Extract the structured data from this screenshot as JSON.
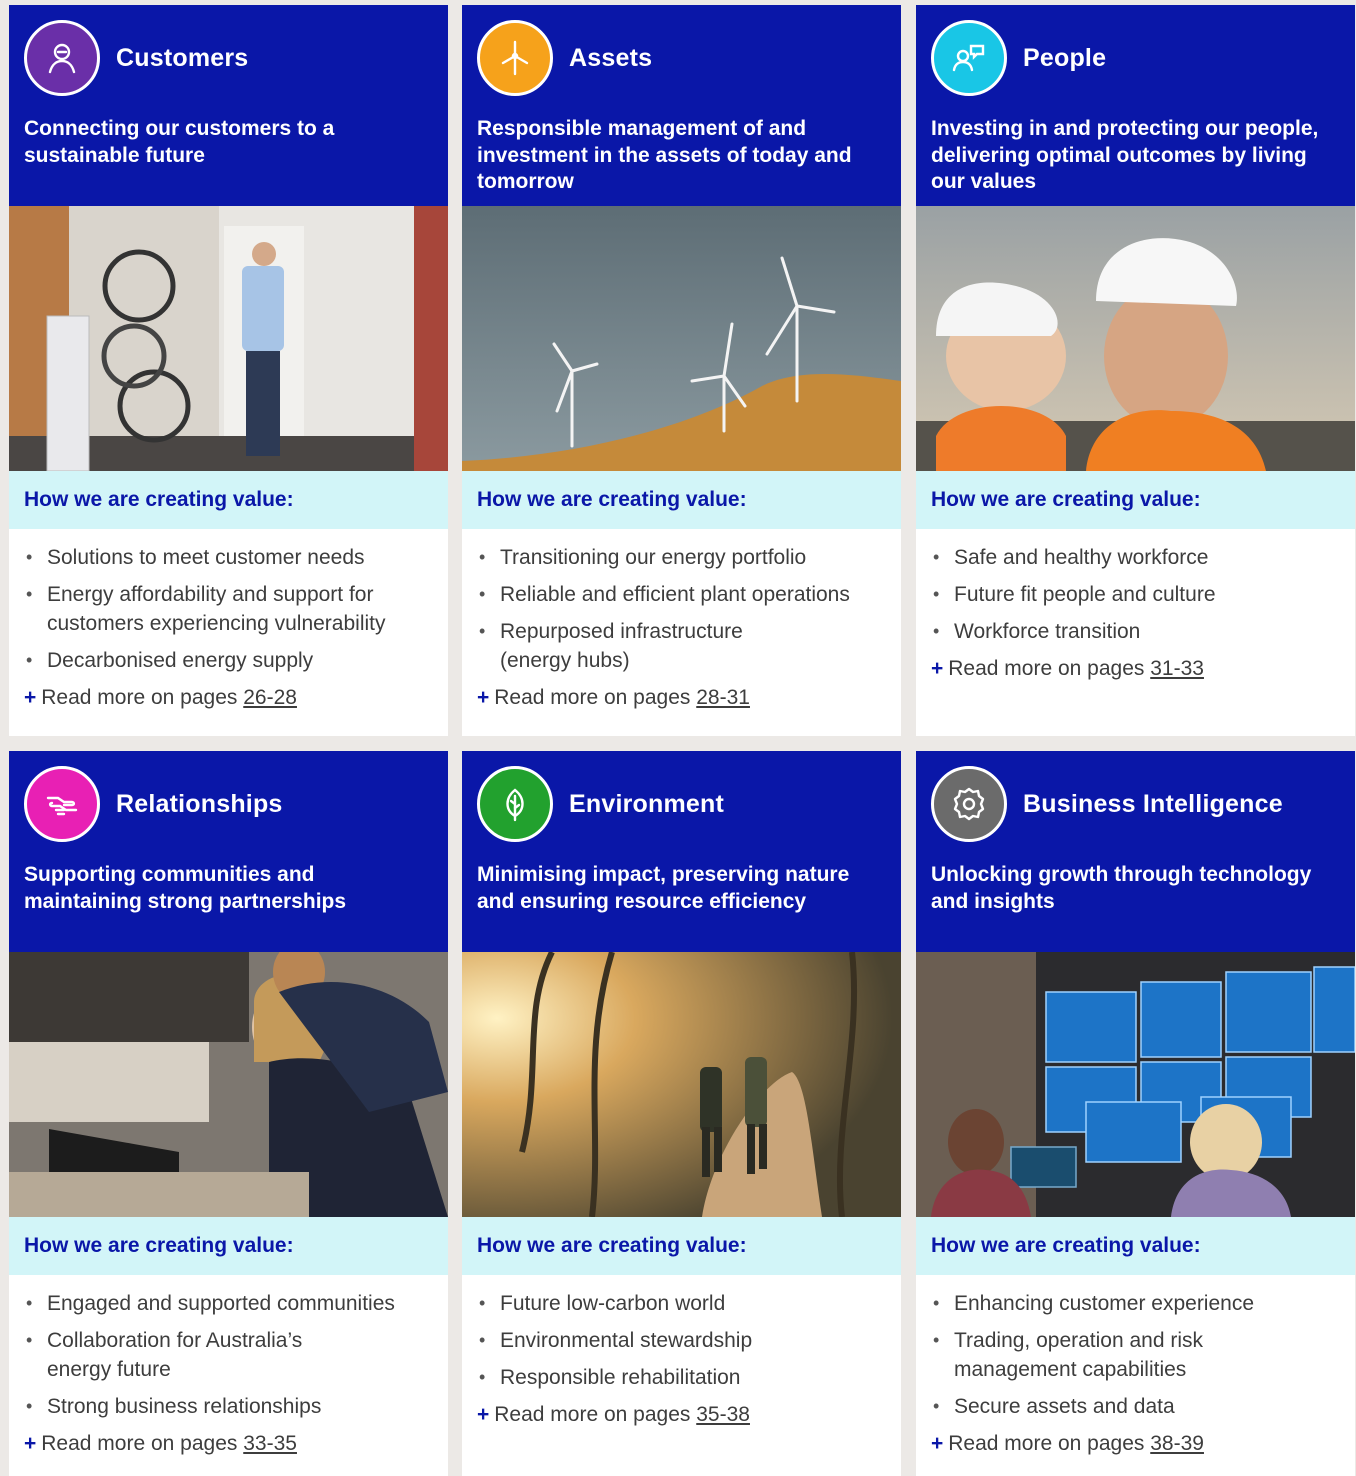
{
  "colors": {
    "header_bg": "#0a17a8",
    "band_bg": "#d2f5f8",
    "customers": "#6a2fa8",
    "assets": "#f6a21b",
    "people": "#19c6e6",
    "relationships": "#e820b4",
    "environment": "#22a12e",
    "business": "#6b6b6b"
  },
  "cards": [
    {
      "title": "Customers",
      "icon": "person-icon",
      "subtitle": "Connecting our customers to a sustainable future",
      "photo": "man-with-bikes-and-home-battery-photo",
      "band": "How we are creating value:",
      "bullets": [
        "Solutions to meet customer needs",
        "Energy affordability and support for customers experiencing vulnerability",
        "Decarbonised energy supply"
      ],
      "read_prefix": "Read more on pages",
      "read_pages": "26-28"
    },
    {
      "title": "Assets",
      "icon": "wind-turbine-icon",
      "subtitle": "Responsible management of and investment in the assets of today and tomorrow",
      "photo": "wind-turbines-on-hill-photo",
      "band": "How we are creating value:",
      "bullets": [
        "Transitioning our energy portfolio",
        "Reliable and efficient plant operations",
        "Repurposed infrastructure (energy hubs)"
      ],
      "read_prefix": "Read more on pages",
      "read_pages": "28-31"
    },
    {
      "title": "People",
      "icon": "people-chat-icon",
      "subtitle": "Investing in and protecting our people, delivering optimal outcomes by living our values",
      "photo": "workers-in-hard-hats-photo",
      "band": "How we are creating value:",
      "bullets": [
        "Safe and healthy workforce",
        "Future fit people and culture",
        "Workforce transition"
      ],
      "read_prefix": "Read more on pages",
      "read_pages": "31-33"
    },
    {
      "title": "Relationships",
      "icon": "handshake-icon",
      "subtitle": "Supporting communities and maintaining strong partnerships",
      "photo": "colleagues-at-laptop-photo",
      "band": "How we are creating value:",
      "bullets": [
        "Engaged and supported communities",
        "Collaboration for Australia’s energy future",
        "Strong business relationships"
      ],
      "read_prefix": "Read more on pages",
      "read_pages": "33-35"
    },
    {
      "title": "Environment",
      "icon": "leaf-icon",
      "subtitle": "Minimising impact, preserving nature and ensuring resource efficiency",
      "photo": "people-walking-bush-track-photo",
      "band": "How we are creating value:",
      "bullets": [
        "Future low-carbon world",
        "Environmental stewardship",
        "Responsible rehabilitation"
      ],
      "read_prefix": "Read more on pages",
      "read_pages": "35-38"
    },
    {
      "title": "Business Intelligence",
      "icon": "gear-icon",
      "subtitle": "Unlocking growth through technology and insights",
      "photo": "control-room-screens-photo",
      "band": "How we are creating value:",
      "bullets": [
        "Enhancing customer experience",
        "Trading, operation and risk management capabilities",
        "Secure assets and data"
      ],
      "read_prefix": "Read more on pages",
      "read_pages": "38-39"
    }
  ]
}
